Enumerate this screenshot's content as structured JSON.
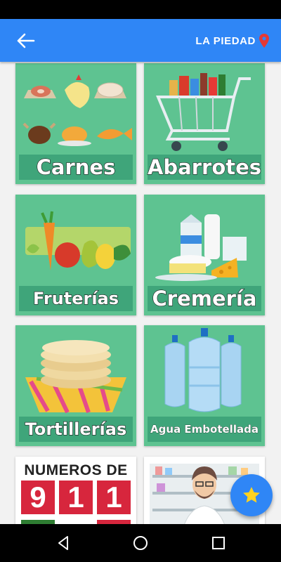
{
  "app_bar": {
    "location": "LA PIEDAD",
    "back_icon": "arrow-left-icon",
    "location_icon": "map-pin-icon",
    "color": "#2f86f6"
  },
  "categories": [
    {
      "label": "Carnes",
      "icon": "meats-illustration"
    },
    {
      "label": "Abarrotes",
      "icon": "shopping-cart-illustration"
    },
    {
      "label": "Fruterías",
      "icon": "fruits-illustration"
    },
    {
      "label": "Cremería",
      "icon": "dairy-illustration"
    },
    {
      "label": "Tortillerías",
      "icon": "tortillas-illustration"
    },
    {
      "label": "Agua Embotellada",
      "icon": "water-jugs-illustration"
    },
    {
      "label": "NUMEROS DE",
      "numbers": [
        "9",
        "1",
        "1"
      ],
      "icon": "emergency-numbers-illustration"
    },
    {
      "label": "",
      "icon": "pharmacist-illustration"
    }
  ],
  "fab": {
    "icon": "star-icon"
  },
  "nav": {
    "back_icon": "nav-back-icon",
    "home_icon": "nav-home-icon",
    "recents_icon": "nav-recents-icon"
  },
  "colors": {
    "tile": "#5ec391",
    "label_band": "#3fa57a",
    "accent": "#d7263d",
    "star": "#ffd21f"
  }
}
